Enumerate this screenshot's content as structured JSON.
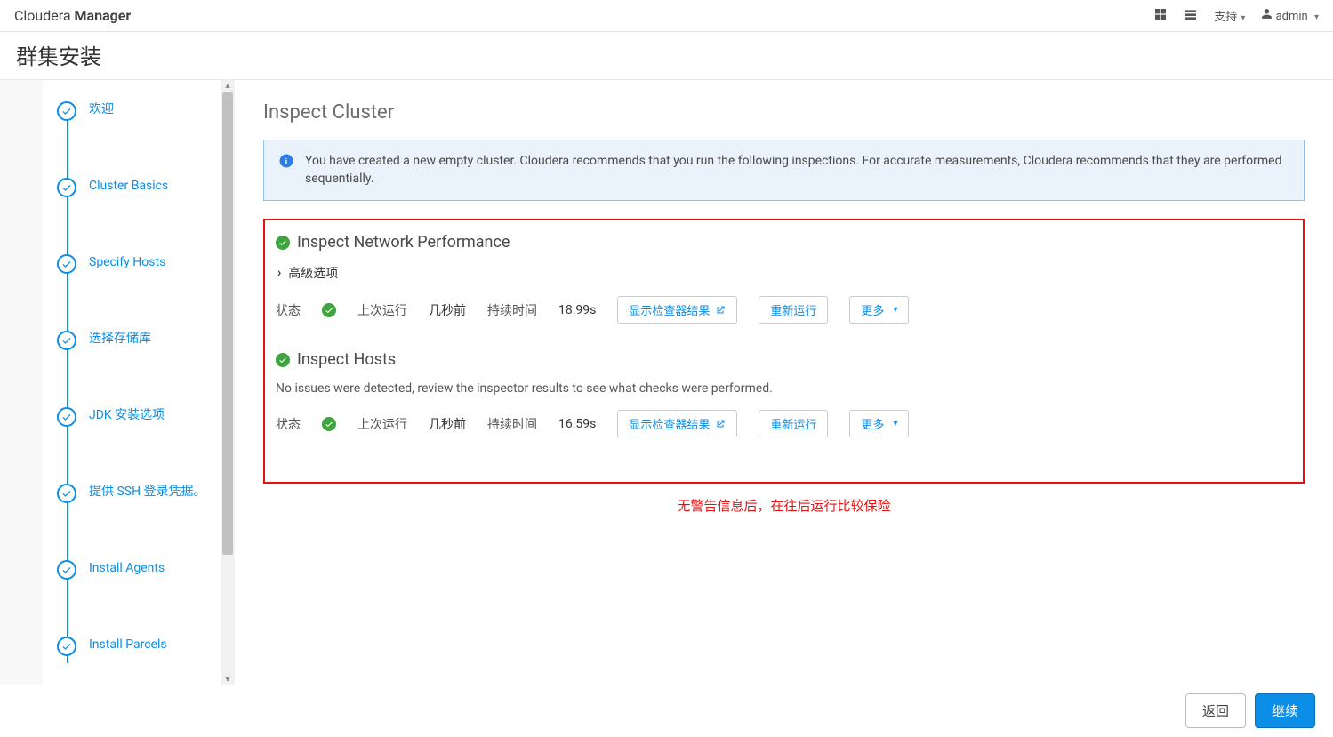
{
  "brand": {
    "name1": "Cloudera",
    "name2": "Manager"
  },
  "topbar": {
    "support": "支持",
    "user": "admin"
  },
  "page_title": "群集安装",
  "wizard": {
    "steps": [
      "欢迎",
      "Cluster Basics",
      "Specify Hosts",
      "选择存储库",
      "JDK 安装选项",
      "提供 SSH 登录凭据。",
      "Install Agents",
      "Install Parcels"
    ]
  },
  "content": {
    "title": "Inspect Cluster",
    "info_text": "You have created a new empty cluster. Cloudera recommends that you run the following inspections. For accurate measurements, Cloudera recommends that they are performed sequentially.",
    "insp_network": {
      "title": "Inspect Network Performance",
      "adv_options": "高级选项",
      "status_lbl": "状态",
      "last_run_lbl": "上次运行",
      "last_run_val": "几秒前",
      "duration_lbl": "持续时间",
      "duration_val": "18.99s",
      "btn_show": "显示检查器结果",
      "btn_rerun": "重新运行",
      "btn_more": "更多"
    },
    "insp_hosts": {
      "title": "Inspect Hosts",
      "subtext": "No issues were detected, review the inspector results to see what checks were performed.",
      "status_lbl": "状态",
      "last_run_lbl": "上次运行",
      "last_run_val": "几秒前",
      "duration_lbl": "持续时间",
      "duration_val": "16.59s",
      "btn_show": "显示检查器结果",
      "btn_rerun": "重新运行",
      "btn_more": "更多"
    },
    "red_note": "无警告信息后，在往后运行比较保险"
  },
  "footer": {
    "back": "返回",
    "next": "继续"
  }
}
